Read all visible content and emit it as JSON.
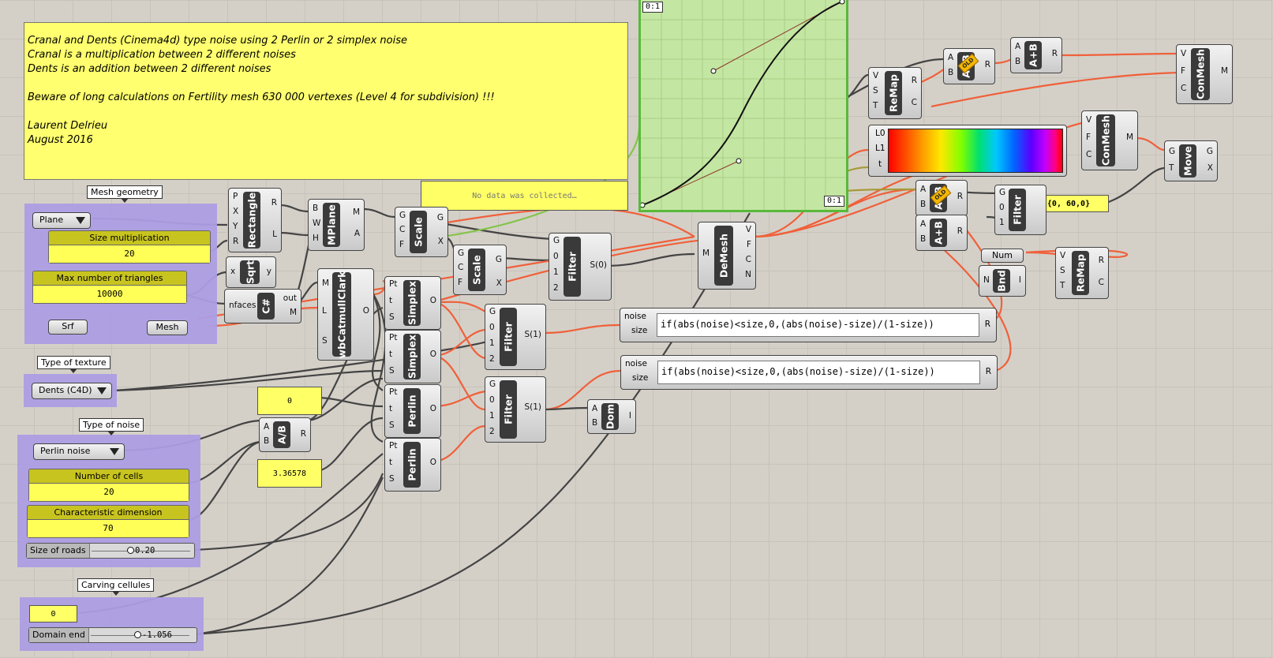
{
  "note": {
    "lines": [
      "Cranal and Dents (Cinema4d) type noise using 2 Perlin or 2 simplex noise",
      "Cranal is a multiplication between 2 different noises",
      "Dents is an addition between 2 different noises",
      "",
      "Beware of long calculations on Fertility mesh 630 000 vertexes (Level 4 for subdivision) !!!",
      "",
      "Laurent Delrieu",
      "August 2016"
    ]
  },
  "groups": {
    "mesh_geometry": "Mesh geometry",
    "type_of_texture": "Type of texture",
    "type_of_noise": "Type of noise",
    "carving_cellules": "Carving cellules"
  },
  "inputs": {
    "plane_dropdown": "Plane",
    "size_multiplication": {
      "title": "Size multiplication",
      "value": "20"
    },
    "max_triangles": {
      "title": "Max number of triangles",
      "value": "10000"
    },
    "srf": "Srf",
    "mesh": "Mesh",
    "texture_dropdown": "Dents (C4D)",
    "noise_dropdown": "Perlin noise",
    "number_of_cells": {
      "title": "Number of cells",
      "value": "20"
    },
    "characteristic_dimension": {
      "title": "Characteristic dimension",
      "value": "70"
    },
    "size_of_roads": {
      "label": "Size of roads",
      "value": "0.20",
      "fraction": 0.5
    },
    "carving_zero": "0",
    "domain_end": {
      "label": "Domain end",
      "value": "-1.056",
      "fraction": 0.6
    }
  },
  "panels": {
    "no_data": "No data was collected…",
    "zero": "0",
    "pi_val": "3.36578",
    "vector": "{0, 60,0}"
  },
  "graph": {
    "top_tag": "0:1",
    "bottom_tag": "0:1"
  },
  "expressions": {
    "e1": {
      "in1": "noise",
      "in2": "size",
      "code": "if(abs(noise)<size,0,(abs(noise)-size)/(1-size))",
      "out": "R"
    },
    "e2": {
      "in1": "noise",
      "in2": "size",
      "code": "if(abs(noise)<size,0,(abs(noise)-size)/(1-size))",
      "out": "R"
    }
  },
  "gradient": {
    "l0": "L0",
    "l1": "L1",
    "t": "t"
  },
  "components": {
    "rectangle": {
      "name": "Rectangle",
      "ins": [
        "P",
        "X",
        "Y",
        "R"
      ],
      "outs": [
        "R",
        "L"
      ]
    },
    "mplane": {
      "name": "MPlane",
      "ins": [
        "B",
        "W",
        "H"
      ],
      "outs": [
        "M",
        "A"
      ]
    },
    "scale1": {
      "name": "Scale",
      "ins": [
        "G",
        "C",
        "F"
      ],
      "outs": [
        "G",
        "X"
      ]
    },
    "scale2": {
      "name": "Scale",
      "ins": [
        "G",
        "C",
        "F"
      ],
      "outs": [
        "G",
        "X"
      ]
    },
    "sqrt": {
      "name": "Sqrt",
      "ins": [
        "x"
      ],
      "outs": [
        "y"
      ]
    },
    "csharp": {
      "name": "C#",
      "ins": [
        "nfaces"
      ],
      "outs": [
        "out",
        "M"
      ]
    },
    "wbcatmull": {
      "name": "wbCatmullClark",
      "ins": [
        "M",
        "L",
        "S"
      ],
      "outs": [
        "O"
      ]
    },
    "simplex1": {
      "name": "Simplex",
      "ins": [
        "Pt",
        "t",
        "S"
      ],
      "outs": [
        "O"
      ]
    },
    "simplex2": {
      "name": "Simplex",
      "ins": [
        "Pt",
        "t",
        "S"
      ],
      "outs": [
        "O"
      ]
    },
    "perlin1": {
      "name": "Perlin",
      "ins": [
        "Pt",
        "t",
        "S"
      ],
      "outs": [
        "O"
      ]
    },
    "perlin2": {
      "name": "Perlin",
      "ins": [
        "Pt",
        "t",
        "S"
      ],
      "outs": [
        "O"
      ]
    },
    "divide": {
      "name": "A/B",
      "ins": [
        "A",
        "B"
      ],
      "outs": [
        "R"
      ]
    },
    "filter0": {
      "name": "Filter",
      "ins": [
        "G",
        "0",
        "1",
        "2"
      ],
      "outs": [
        "S(0)"
      ]
    },
    "filter1": {
      "name": "Filter",
      "ins": [
        "G",
        "0",
        "1",
        "2"
      ],
      "outs": [
        "S(1)"
      ]
    },
    "filter2": {
      "name": "Filter",
      "ins": [
        "G",
        "0",
        "1",
        "2"
      ],
      "outs": [
        "S(1)"
      ]
    },
    "filter3": {
      "name": "Filter",
      "ins": [
        "G",
        "0",
        "1"
      ],
      "outs": []
    },
    "dom": {
      "name": "Dom",
      "ins": [
        "A",
        "B"
      ],
      "outs": [
        "I"
      ]
    },
    "demesh": {
      "name": "DeMesh",
      "ins": [
        "M"
      ],
      "outs": [
        "V",
        "F",
        "C",
        "N"
      ]
    },
    "remap1": {
      "name": "ReMap",
      "ins": [
        "V",
        "S",
        "T"
      ],
      "outs": [
        "R",
        "C"
      ]
    },
    "remap2": {
      "name": "ReMap",
      "ins": [
        "V",
        "S",
        "T"
      ],
      "outs": [
        "R",
        "C"
      ]
    },
    "mult1": {
      "name": "A×B",
      "ins": [
        "A",
        "B"
      ],
      "outs": [
        "R"
      ],
      "badge": "OLD"
    },
    "mult2": {
      "name": "A×B",
      "ins": [
        "A",
        "B"
      ],
      "outs": [
        "R"
      ],
      "badge": "OLD"
    },
    "add1": {
      "name": "A+B",
      "ins": [
        "A",
        "B"
      ],
      "outs": [
        "R"
      ]
    },
    "add2": {
      "name": "A+B",
      "ins": [
        "A",
        "B"
      ],
      "outs": [
        "R"
      ]
    },
    "conmesh1": {
      "name": "ConMesh",
      "ins": [
        "V",
        "F",
        "C"
      ],
      "outs": [
        "M"
      ]
    },
    "conmesh2": {
      "name": "ConMesh",
      "ins": [
        "V",
        "F",
        "C"
      ],
      "outs": [
        "M"
      ]
    },
    "move": {
      "name": "Move",
      "ins": [
        "G",
        "T"
      ],
      "outs": [
        "G",
        "X"
      ]
    },
    "num": {
      "name": "Num"
    },
    "bnd": {
      "name": "Bnd",
      "ins": [
        "N"
      ],
      "outs": [
        "I"
      ]
    }
  },
  "colors": {
    "canvas": "#d4d0c8",
    "group": "#ad9de4",
    "panel": "#ffff66",
    "wire_active": "#f0603a",
    "wire_default": "#4a4a4a",
    "graph_bg": "#c4e6a3"
  }
}
